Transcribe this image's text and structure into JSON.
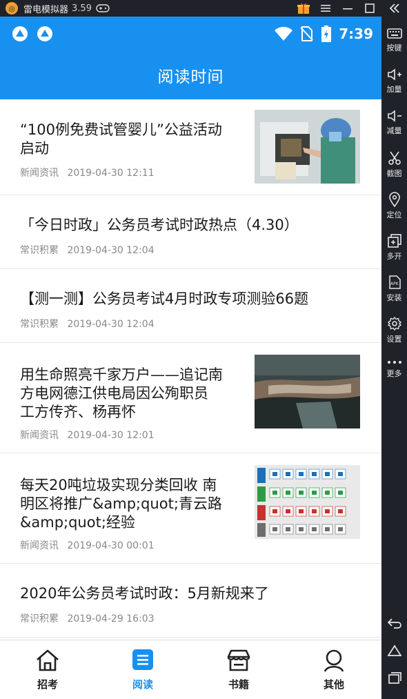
{
  "emulator": {
    "title": "雷电模拟器",
    "version": "3.59",
    "sidebar": [
      {
        "icon": "keyboard-icon",
        "label": "按键"
      },
      {
        "icon": "volume-up-icon",
        "label": "加量"
      },
      {
        "icon": "volume-down-icon",
        "label": "减量"
      },
      {
        "icon": "scissors-icon",
        "label": "截图"
      },
      {
        "icon": "location-icon",
        "label": "定位"
      },
      {
        "icon": "multi-open-icon",
        "label": "多开"
      },
      {
        "icon": "apk-install-icon",
        "label": "安装"
      },
      {
        "icon": "settings-icon",
        "label": "设置"
      },
      {
        "icon": "more-icon",
        "label": "更多"
      }
    ]
  },
  "status": {
    "time": "7:39"
  },
  "appbar": {
    "title": "阅读时间"
  },
  "articles": [
    {
      "title_lines": [
        "“100例免费试管婴儿”公益活动",
        "启动"
      ],
      "category": "新闻资讯",
      "datetime": "2019-04-30 12:11",
      "thumb": "lab-photo"
    },
    {
      "title_lines": [
        "「今日时政」公务员考试时政热点（4.30）"
      ],
      "category": "常识积累",
      "datetime": "2019-04-30 12:04"
    },
    {
      "title_lines": [
        "【测一测】公务员考试4月时政专项测验66题"
      ],
      "category": "常识积累",
      "datetime": "2019-04-30 12:04"
    },
    {
      "title_lines": [
        "用生命照亮千家万户——追记南",
        "方电网德江供电局因公殉职员",
        "工方传齐、杨再怀"
      ],
      "category": "新闻资讯",
      "datetime": "2019-04-30 12:01",
      "thumb": "flood-photo"
    },
    {
      "title_lines": [
        "每天20吨垃圾实现分类回收 南",
        "明区将推广&amp;quot;青云路",
        "&amp;quot;经验"
      ],
      "category": "新闻资讯",
      "datetime": "2019-04-30 00:01",
      "thumb": "garbage-chart"
    },
    {
      "title_lines": [
        "2020年公务员考试时政：5月新规来了"
      ],
      "category": "常识积累",
      "datetime": "2019-04-29 16:03"
    }
  ],
  "nav": [
    {
      "label": "招考",
      "icon": "home-icon",
      "active": false
    },
    {
      "label": "阅读",
      "icon": "reading-icon",
      "active": true
    },
    {
      "label": "书籍",
      "icon": "store-icon",
      "active": false
    },
    {
      "label": "其他",
      "icon": "user-icon",
      "active": false
    }
  ],
  "colors": {
    "primary": "#1890f0",
    "sidebar_bg": "#1f2329",
    "meta_text": "#888888"
  }
}
